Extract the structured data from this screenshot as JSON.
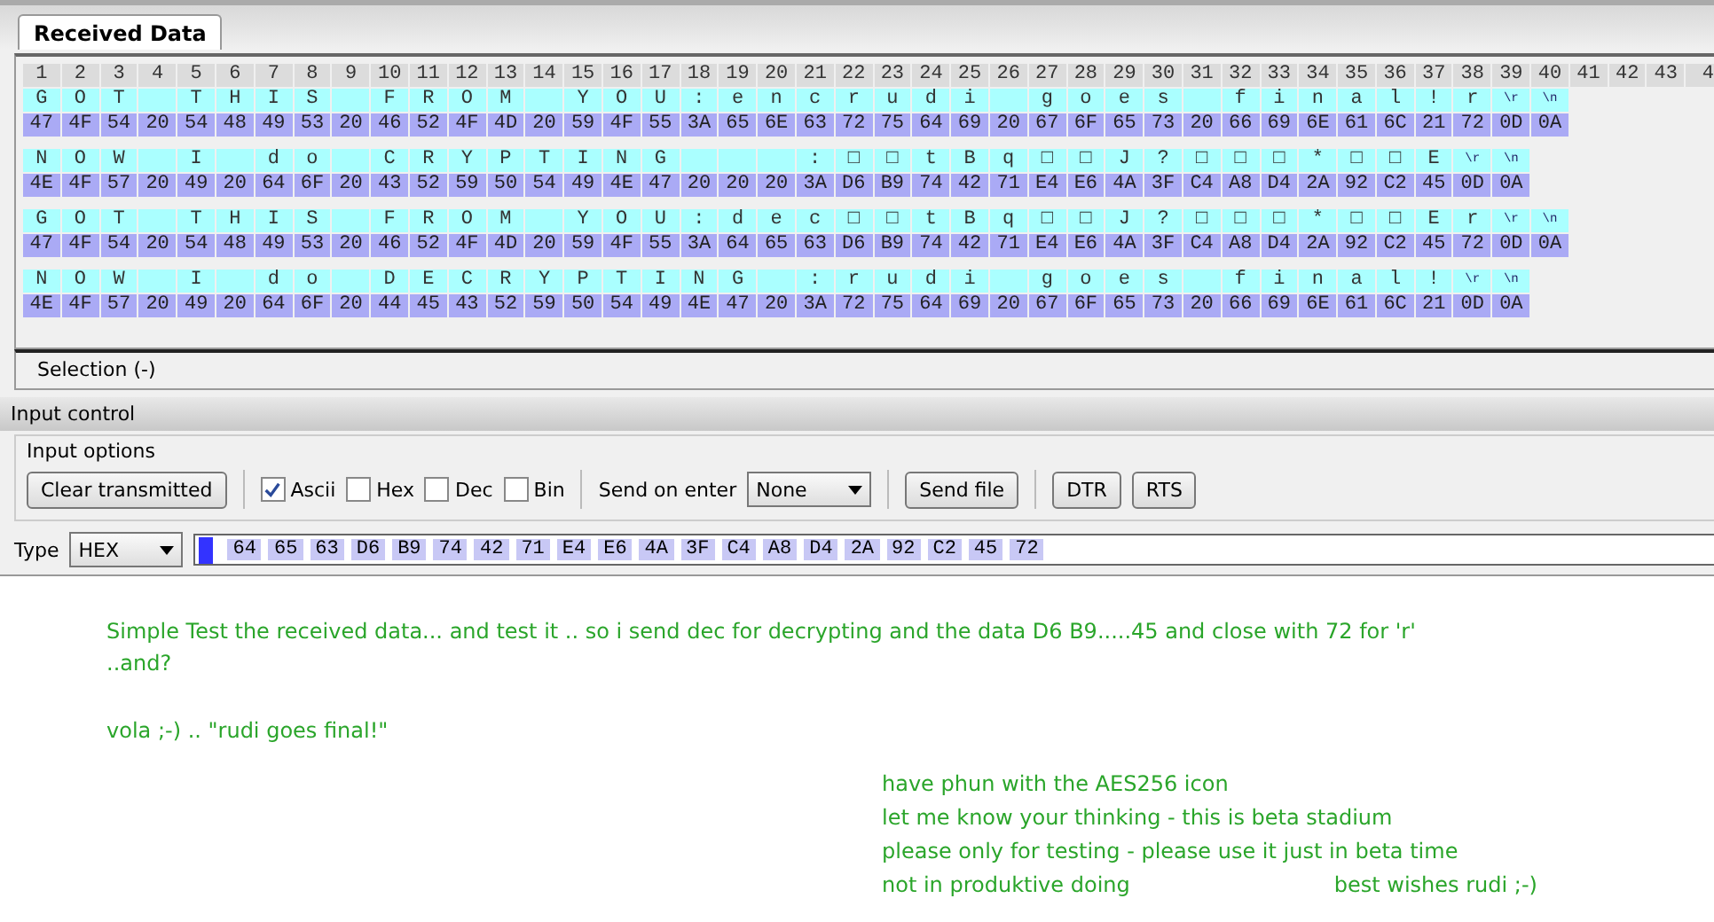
{
  "tabs": [
    {
      "label": "Received Data",
      "selected": true
    }
  ],
  "column_numbers": [
    "1",
    "2",
    "3",
    "4",
    "5",
    "6",
    "7",
    "8",
    "9",
    "10",
    "11",
    "12",
    "13",
    "14",
    "15",
    "16",
    "17",
    "18",
    "19",
    "20",
    "21",
    "22",
    "23",
    "24",
    "25",
    "26",
    "27",
    "28",
    "29",
    "30",
    "31",
    "32",
    "33",
    "34",
    "35",
    "36",
    "37",
    "38",
    "39",
    "40",
    "41",
    "42",
    "43",
    "4"
  ],
  "rows": [
    {
      "cells": [
        {
          "c": "G",
          "h": "47"
        },
        {
          "c": "O",
          "h": "4F"
        },
        {
          "c": "T",
          "h": "54"
        },
        {
          "h": "20"
        },
        {
          "c": "T",
          "h": "54"
        },
        {
          "c": "H",
          "h": "48"
        },
        {
          "c": "I",
          "h": "49"
        },
        {
          "c": "S",
          "h": "53"
        },
        {
          "h": "20"
        },
        {
          "c": "F",
          "h": "46"
        },
        {
          "c": "R",
          "h": "52"
        },
        {
          "c": "O",
          "h": "4F"
        },
        {
          "c": "M",
          "h": "4D"
        },
        {
          "h": "20"
        },
        {
          "c": "Y",
          "h": "59"
        },
        {
          "c": "O",
          "h": "4F"
        },
        {
          "c": "U",
          "h": "55"
        },
        {
          "c": ":",
          "h": "3A"
        },
        {
          "c": "e",
          "h": "65"
        },
        {
          "c": "n",
          "h": "6E"
        },
        {
          "c": "c",
          "h": "63"
        },
        {
          "c": "r",
          "h": "72"
        },
        {
          "c": "u",
          "h": "75"
        },
        {
          "c": "d",
          "h": "64"
        },
        {
          "c": "i",
          "h": "69"
        },
        {
          "h": "20"
        },
        {
          "c": "g",
          "h": "67"
        },
        {
          "c": "o",
          "h": "6F"
        },
        {
          "c": "e",
          "h": "65"
        },
        {
          "c": "s",
          "h": "73"
        },
        {
          "h": "20"
        },
        {
          "c": "f",
          "h": "66"
        },
        {
          "c": "i",
          "h": "69"
        },
        {
          "c": "n",
          "h": "6E"
        },
        {
          "c": "a",
          "h": "61"
        },
        {
          "c": "l",
          "h": "6C"
        },
        {
          "c": "!",
          "h": "21"
        },
        {
          "c": "r",
          "h": "72"
        },
        {
          "c": "\\r",
          "h": "0D"
        },
        {
          "c": "\\n",
          "h": "0A"
        }
      ]
    },
    {
      "cells": [
        {
          "c": "N",
          "h": "4E"
        },
        {
          "c": "O",
          "h": "4F"
        },
        {
          "c": "W",
          "h": "57"
        },
        {
          "h": "20"
        },
        {
          "c": "I",
          "h": "49"
        },
        {
          "h": "20"
        },
        {
          "c": "d",
          "h": "64"
        },
        {
          "c": "o",
          "h": "6F"
        },
        {
          "h": "20"
        },
        {
          "c": "C",
          "h": "43"
        },
        {
          "c": "R",
          "h": "52"
        },
        {
          "c": "Y",
          "h": "59"
        },
        {
          "c": "P",
          "h": "50"
        },
        {
          "c": "T",
          "h": "54"
        },
        {
          "c": "I",
          "h": "49"
        },
        {
          "c": "N",
          "h": "4E"
        },
        {
          "c": "G",
          "h": "47"
        },
        {
          "h": "20"
        },
        {
          "h": "20"
        },
        {
          "h": "20"
        },
        {
          "c": ":",
          "h": "3A"
        },
        {
          "c": "□",
          "h": "D6"
        },
        {
          "c": "□",
          "h": "B9"
        },
        {
          "c": "t",
          "h": "74"
        },
        {
          "c": "B",
          "h": "42"
        },
        {
          "c": "q",
          "h": "71"
        },
        {
          "c": "□",
          "h": "E4"
        },
        {
          "c": "□",
          "h": "E6"
        },
        {
          "c": "J",
          "h": "4A"
        },
        {
          "c": "?",
          "h": "3F"
        },
        {
          "c": "□",
          "h": "C4"
        },
        {
          "c": "□",
          "h": "A8"
        },
        {
          "c": "□",
          "h": "D4"
        },
        {
          "c": "*",
          "h": "2A"
        },
        {
          "c": "□",
          "h": "92"
        },
        {
          "c": "□",
          "h": "C2"
        },
        {
          "c": "E",
          "h": "45"
        },
        {
          "c": "\\r",
          "h": "0D"
        },
        {
          "c": "\\n",
          "h": "0A"
        }
      ]
    },
    {
      "cells": [
        {
          "c": "G",
          "h": "47"
        },
        {
          "c": "O",
          "h": "4F"
        },
        {
          "c": "T",
          "h": "54"
        },
        {
          "h": "20"
        },
        {
          "c": "T",
          "h": "54"
        },
        {
          "c": "H",
          "h": "48"
        },
        {
          "c": "I",
          "h": "49"
        },
        {
          "c": "S",
          "h": "53"
        },
        {
          "h": "20"
        },
        {
          "c": "F",
          "h": "46"
        },
        {
          "c": "R",
          "h": "52"
        },
        {
          "c": "O",
          "h": "4F"
        },
        {
          "c": "M",
          "h": "4D"
        },
        {
          "h": "20"
        },
        {
          "c": "Y",
          "h": "59"
        },
        {
          "c": "O",
          "h": "4F"
        },
        {
          "c": "U",
          "h": "55"
        },
        {
          "c": ":",
          "h": "3A"
        },
        {
          "c": "d",
          "h": "64"
        },
        {
          "c": "e",
          "h": "65"
        },
        {
          "c": "c",
          "h": "63"
        },
        {
          "c": "□",
          "h": "D6"
        },
        {
          "c": "□",
          "h": "B9"
        },
        {
          "c": "t",
          "h": "74"
        },
        {
          "c": "B",
          "h": "42"
        },
        {
          "c": "q",
          "h": "71"
        },
        {
          "c": "□",
          "h": "E4"
        },
        {
          "c": "□",
          "h": "E6"
        },
        {
          "c": "J",
          "h": "4A"
        },
        {
          "c": "?",
          "h": "3F"
        },
        {
          "c": "□",
          "h": "C4"
        },
        {
          "c": "□",
          "h": "A8"
        },
        {
          "c": "□",
          "h": "D4"
        },
        {
          "c": "*",
          "h": "2A"
        },
        {
          "c": "□",
          "h": "92"
        },
        {
          "c": "□",
          "h": "C2"
        },
        {
          "c": "E",
          "h": "45"
        },
        {
          "c": "r",
          "h": "72"
        },
        {
          "c": "\\r",
          "h": "0D"
        },
        {
          "c": "\\n",
          "h": "0A"
        }
      ]
    },
    {
      "cells": [
        {
          "c": "N",
          "h": "4E"
        },
        {
          "c": "O",
          "h": "4F"
        },
        {
          "c": "W",
          "h": "57"
        },
        {
          "h": "20"
        },
        {
          "c": "I",
          "h": "49"
        },
        {
          "h": "20"
        },
        {
          "c": "d",
          "h": "64"
        },
        {
          "c": "o",
          "h": "6F"
        },
        {
          "h": "20"
        },
        {
          "c": "D",
          "h": "44"
        },
        {
          "c": "E",
          "h": "45"
        },
        {
          "c": "C",
          "h": "43"
        },
        {
          "c": "R",
          "h": "52"
        },
        {
          "c": "Y",
          "h": "59"
        },
        {
          "c": "P",
          "h": "50"
        },
        {
          "c": "T",
          "h": "54"
        },
        {
          "c": "I",
          "h": "49"
        },
        {
          "c": "N",
          "h": "4E"
        },
        {
          "c": "G",
          "h": "47"
        },
        {
          "h": "20"
        },
        {
          "c": ":",
          "h": "3A"
        },
        {
          "c": "r",
          "h": "72"
        },
        {
          "c": "u",
          "h": "75"
        },
        {
          "c": "d",
          "h": "64"
        },
        {
          "c": "i",
          "h": "69"
        },
        {
          "h": "20"
        },
        {
          "c": "g",
          "h": "67"
        },
        {
          "c": "o",
          "h": "6F"
        },
        {
          "c": "e",
          "h": "65"
        },
        {
          "c": "s",
          "h": "73"
        },
        {
          "h": "20"
        },
        {
          "c": "f",
          "h": "66"
        },
        {
          "c": "i",
          "h": "69"
        },
        {
          "c": "n",
          "h": "6E"
        },
        {
          "c": "a",
          "h": "61"
        },
        {
          "c": "l",
          "h": "6C"
        },
        {
          "c": "!",
          "h": "21"
        },
        {
          "c": "\\r",
          "h": "0D"
        },
        {
          "c": "\\n",
          "h": "0A"
        }
      ]
    }
  ],
  "selection_label": "Selection (-)",
  "input_control": {
    "title": "Input control",
    "group": "Input options",
    "controls": [
      {
        "kind": "button",
        "label": "Clear transmitted"
      },
      {
        "kind": "separator"
      },
      {
        "kind": "checkbox",
        "label": "Ascii",
        "checked": true
      },
      {
        "kind": "checkbox",
        "label": "Hex",
        "checked": false
      },
      {
        "kind": "checkbox",
        "label": "Dec",
        "checked": false
      },
      {
        "kind": "checkbox",
        "label": "Bin",
        "checked": false
      },
      {
        "kind": "separator"
      },
      {
        "kind": "dropdown",
        "label": "Send on enter",
        "value": "None"
      },
      {
        "kind": "separator"
      },
      {
        "kind": "button",
        "label": "Send file"
      },
      {
        "kind": "separator"
      },
      {
        "kind": "button",
        "label": "DTR"
      },
      {
        "kind": "button",
        "label": "RTS"
      }
    ],
    "type_label": "Type",
    "type_value": "HEX",
    "input_tokens": [
      "64",
      "65",
      "63",
      "D6",
      "B9",
      "74",
      "42",
      "71",
      "E4",
      "E6",
      "4A",
      "3F",
      "C4",
      "A8",
      "D4",
      "2A",
      "92",
      "C2",
      "45",
      "72"
    ]
  },
  "notes": {
    "paragraphs": [
      "Simple Test the received data... and test it .. so i send dec for decrypting and the data D6 B9.....45 and close with 72 for 'r'\n..and?",
      "vola ;-) .. \"rudi goes final!\""
    ],
    "lines": [
      "have phun with the AES256 icon",
      "let me know your thinking - this is beta stadium",
      "please only for testing - please use it just in beta time",
      "not in produktive doing"
    ],
    "signature": "best wishes rudi ;-)"
  }
}
